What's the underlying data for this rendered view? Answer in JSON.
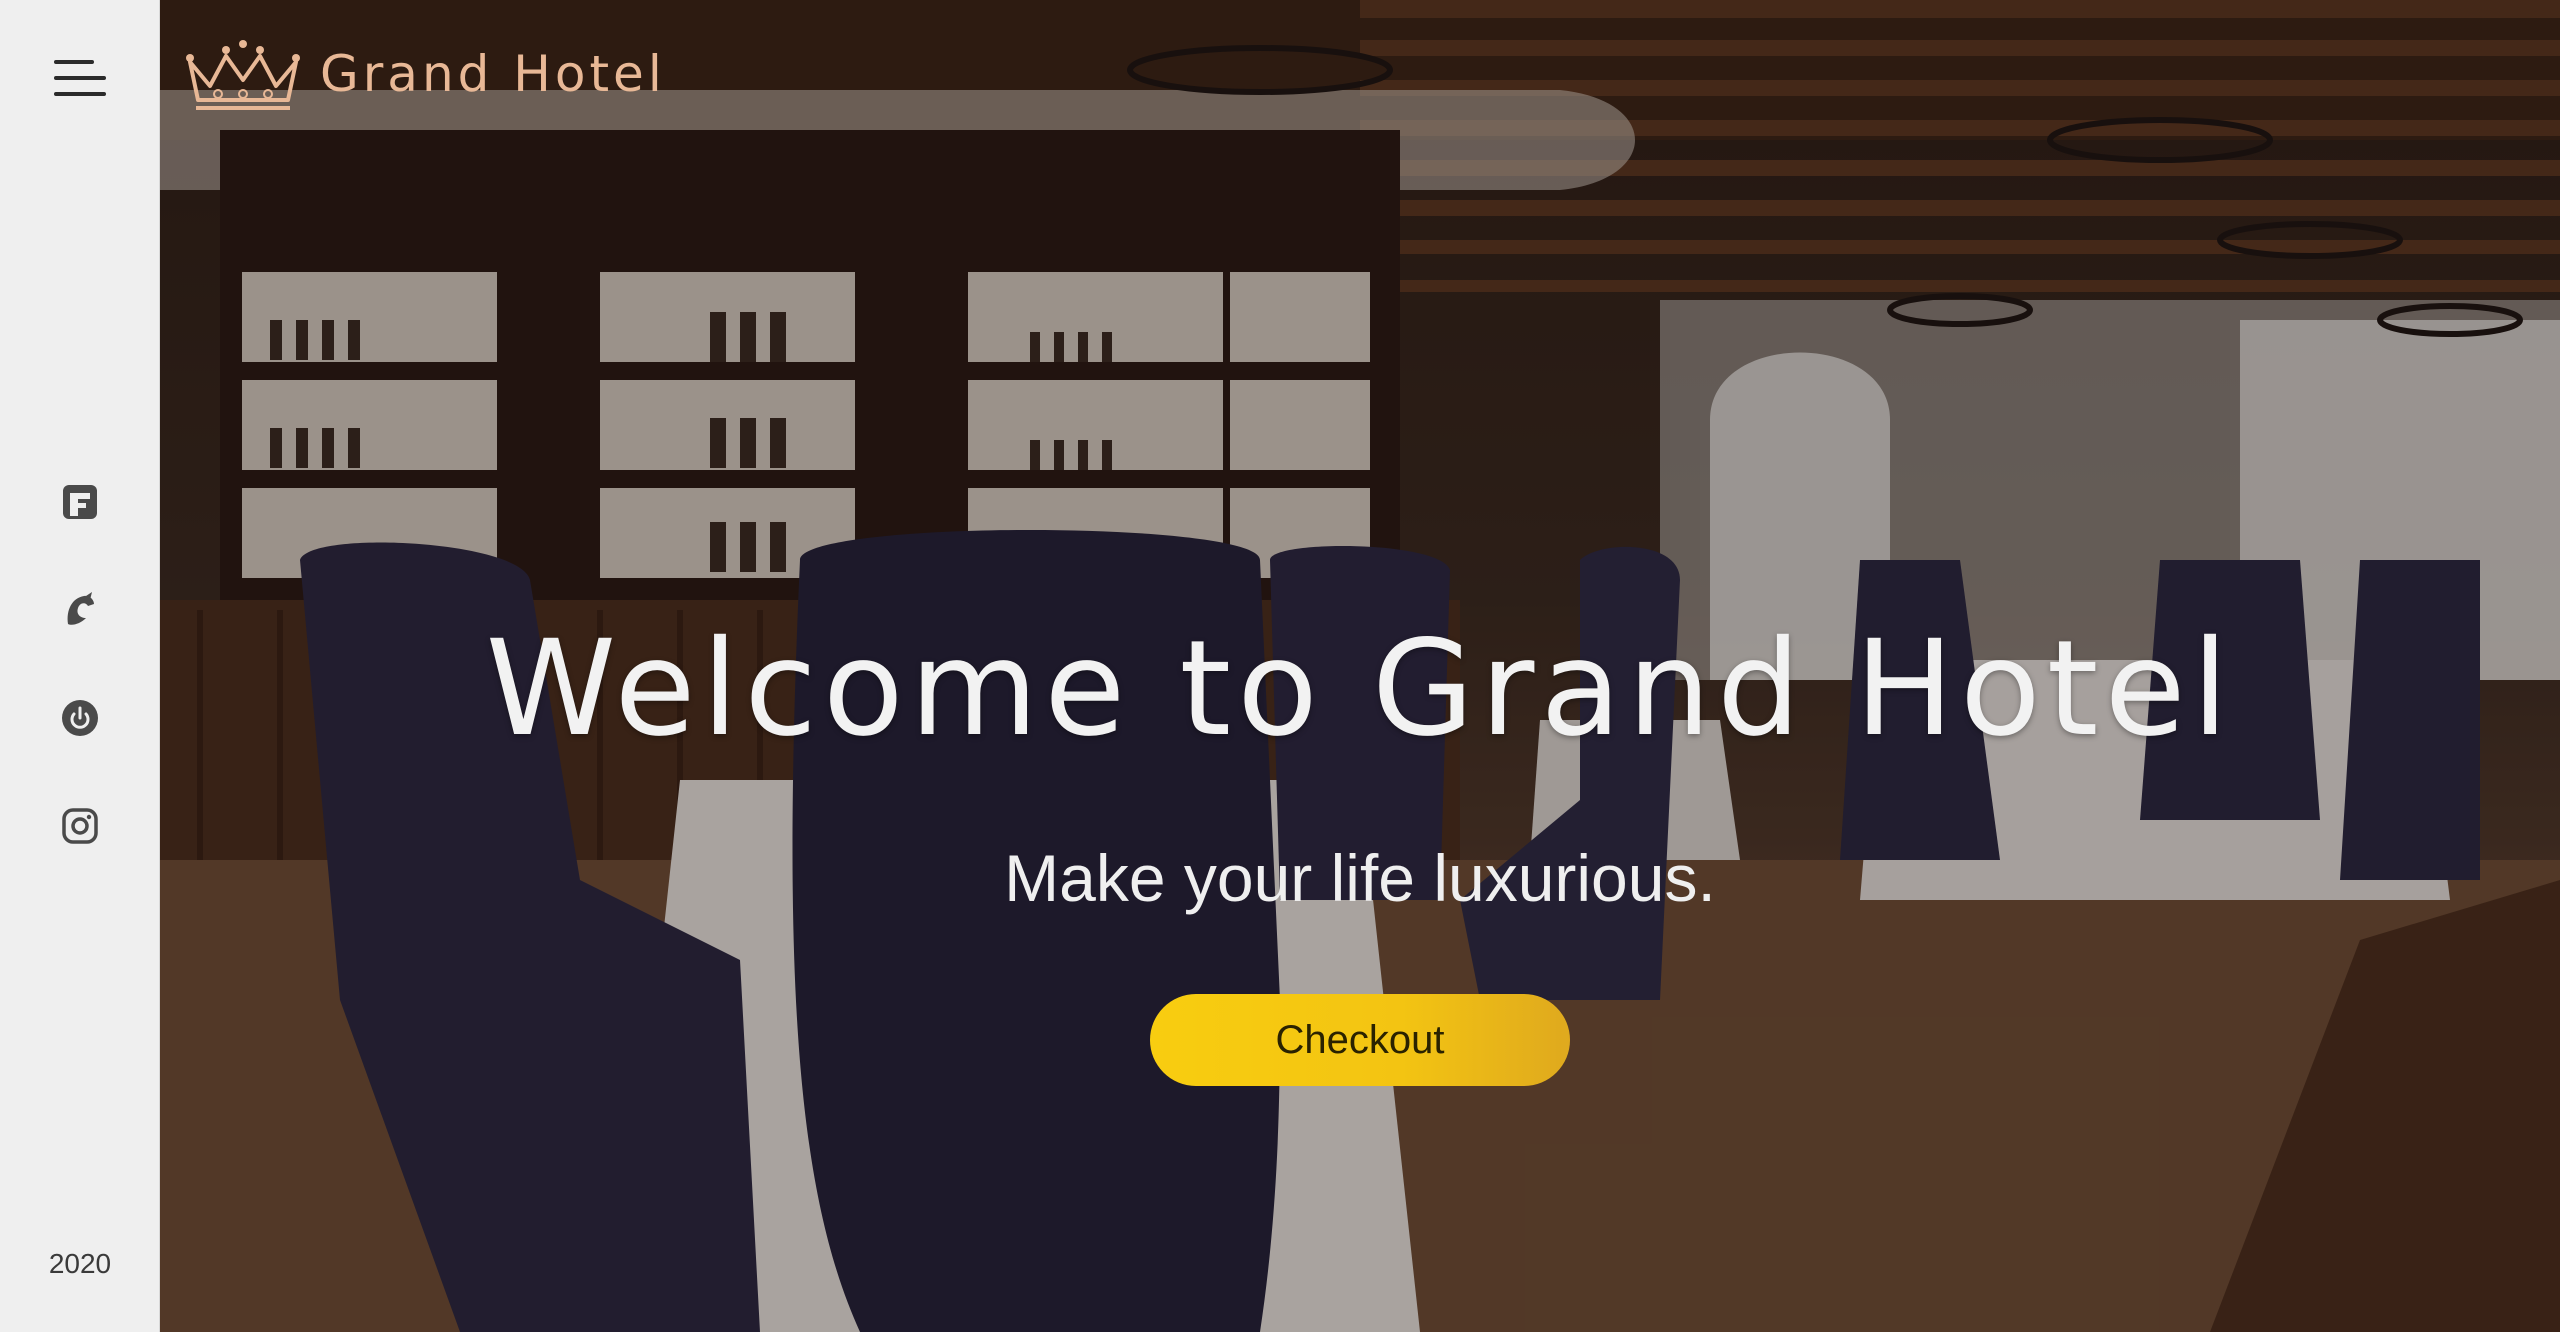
{
  "brand": {
    "name": "Grand Hotel",
    "logo_icon": "crown-icon",
    "logo_color": "#e8b896"
  },
  "sidebar": {
    "menu_icon": "hamburger-menu-icon",
    "social": [
      {
        "name": "foursquare-icon"
      },
      {
        "name": "mastodon-icon"
      },
      {
        "name": "power-toggle-icon"
      },
      {
        "name": "instagram-icon"
      }
    ],
    "year": "2020",
    "background": "#efefef"
  },
  "hero": {
    "headline": "Welcome to Grand Hotel",
    "subline": "Make your life luxurious.",
    "cta_label": "Checkout",
    "cta_color": "#f8cd10"
  }
}
